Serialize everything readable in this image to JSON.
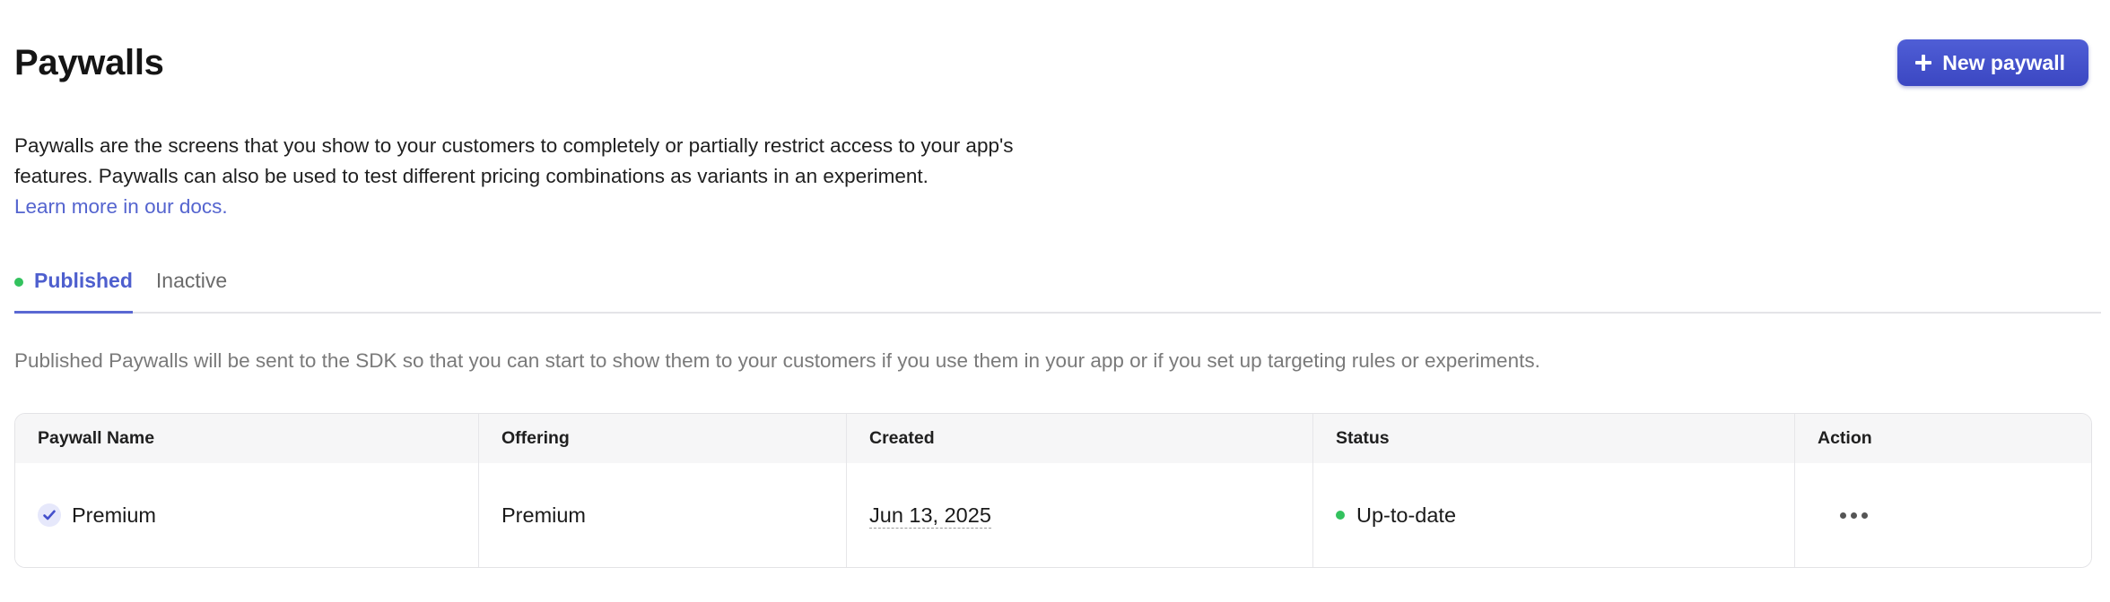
{
  "header": {
    "title": "Paywalls",
    "new_button_label": "New paywall"
  },
  "description": {
    "text": "Paywalls are the screens that you show to your customers to completely or partially restrict access to your app's features. Paywalls can also be used to test different pricing combinations as variants in an experiment.",
    "link_text": "Learn more in our docs."
  },
  "tabs": [
    {
      "label": "Published",
      "active": true
    },
    {
      "label": "Inactive",
      "active": false
    }
  ],
  "subtext": "Published Paywalls will be sent to the SDK so that you can start to show them to your customers if you use them in your app or if you set up targeting rules or experiments.",
  "table": {
    "columns": [
      "Paywall Name",
      "Offering",
      "Created",
      "Status",
      "Action"
    ],
    "rows": [
      {
        "name": "Premium",
        "offering": "Premium",
        "created": "Jun 13, 2025",
        "status": "Up-to-date"
      }
    ]
  },
  "colors": {
    "accent": "#4e5fce",
    "button": "#3f4bc6",
    "status_live": "#33c25e"
  },
  "icons": {
    "new_button": "plus-icon",
    "published_tab": "live-dot-icon",
    "row_name": "check-circle-icon",
    "status": "status-dot-icon",
    "action": "more-horizontal-icon"
  }
}
